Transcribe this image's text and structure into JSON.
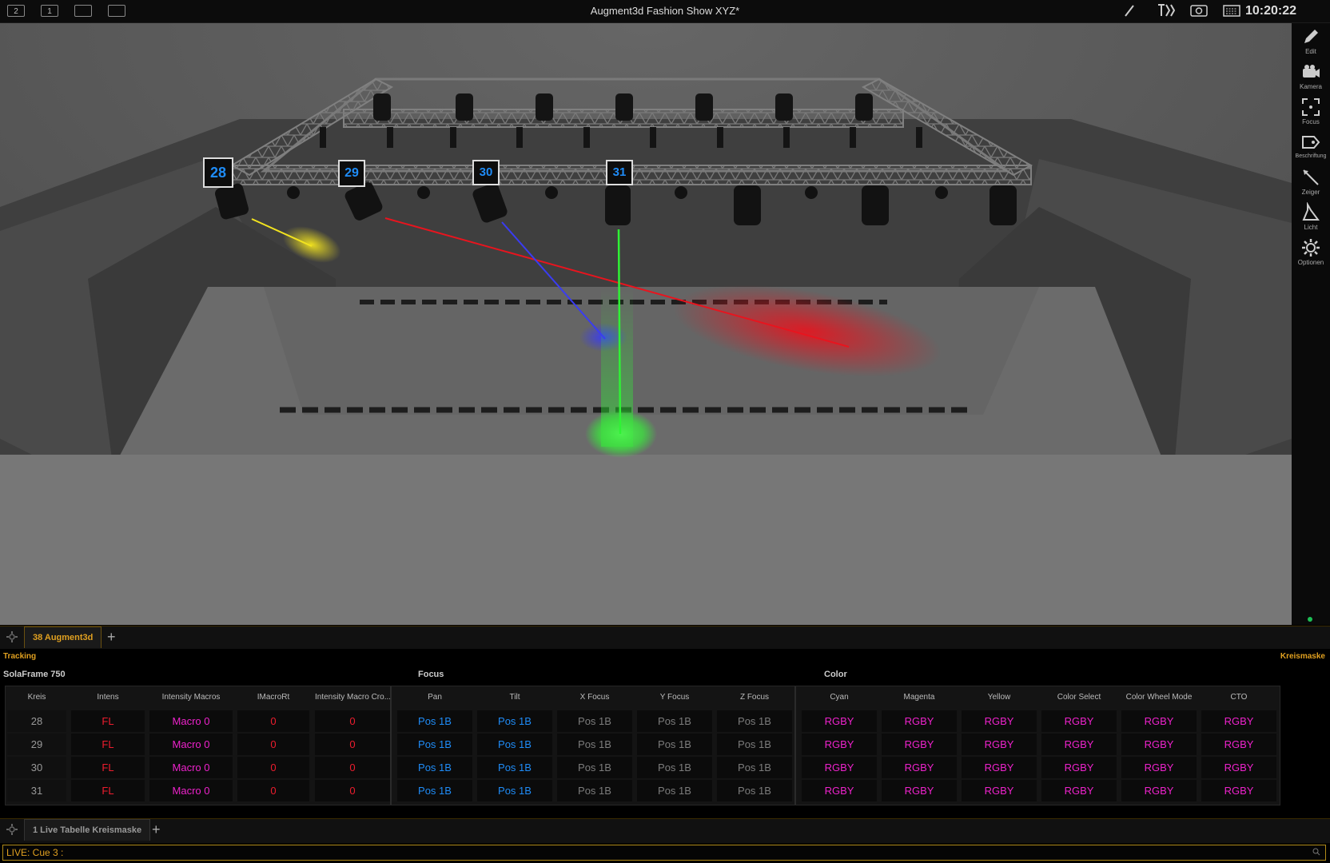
{
  "app": {
    "title": "Augment3d Fashion Show XYZ*",
    "clock": "10:20:22",
    "screen_buttons": [
      "2",
      "1",
      "",
      ""
    ]
  },
  "viewport": {
    "channel_labels": [
      "28",
      "29",
      "30",
      "31"
    ],
    "beam_colors": [
      "#f2e31f",
      "#e8141e",
      "#3a3cf2",
      "#2ff235"
    ]
  },
  "right_toolbar": [
    {
      "label": "Edit",
      "icon": "pencil-icon"
    },
    {
      "label": "Kamera",
      "icon": "camera-icon"
    },
    {
      "label": "Focus",
      "icon": "focus-icon"
    },
    {
      "label": "Beschriftung",
      "icon": "tag-icon"
    },
    {
      "label": "Zeiger",
      "icon": "pointer-icon"
    },
    {
      "label": "Licht",
      "icon": "light-icon"
    },
    {
      "label": "Optionen",
      "icon": "gear-icon"
    }
  ],
  "tabs_top": {
    "active": "38 Augment3d"
  },
  "sheet": {
    "mode_label": "Tracking",
    "mask_label": "Kreismaske",
    "fixture_name": "SolaFrame 750",
    "groups": {
      "focus": "Focus",
      "color": "Color"
    },
    "columns": [
      "Kreis",
      "Intens",
      "Intensity Macros",
      "IMacroRt",
      "Intensity Macro Cro...",
      "Pan",
      "Tilt",
      "X Focus",
      "Y Focus",
      "Z Focus",
      "Cyan",
      "Magenta",
      "Yellow",
      "Color Select",
      "Color Wheel Mode",
      "CTO"
    ],
    "rows": [
      [
        "28",
        "FL",
        "Macro 0",
        "0",
        "0",
        "Pos 1B",
        "Pos 1B",
        "Pos 1B",
        "Pos 1B",
        "Pos 1B",
        "RGBY",
        "RGBY",
        "RGBY",
        "RGBY",
        "RGBY",
        "RGBY"
      ],
      [
        "29",
        "FL",
        "Macro 0",
        "0",
        "0",
        "Pos 1B",
        "Pos 1B",
        "Pos 1B",
        "Pos 1B",
        "Pos 1B",
        "RGBY",
        "RGBY",
        "RGBY",
        "RGBY",
        "RGBY",
        "RGBY"
      ],
      [
        "30",
        "FL",
        "Macro 0",
        "0",
        "0",
        "Pos 1B",
        "Pos 1B",
        "Pos 1B",
        "Pos 1B",
        "Pos 1B",
        "RGBY",
        "RGBY",
        "RGBY",
        "RGBY",
        "RGBY",
        "RGBY"
      ],
      [
        "31",
        "FL",
        "Macro 0",
        "0",
        "0",
        "Pos 1B",
        "Pos 1B",
        "Pos 1B",
        "Pos 1B",
        "Pos 1B",
        "RGBY",
        "RGBY",
        "RGBY",
        "RGBY",
        "RGBY",
        "RGBY"
      ]
    ]
  },
  "tabs_bottom": {
    "active": "1 Live Tabelle Kreismaske"
  },
  "command_line": "LIVE: Cue  3 :",
  "colors": {
    "accent": "#e0a020",
    "red_value": "#ee1d2e",
    "magenta_value": "#ee22cc",
    "blue_value": "#1f8cf7",
    "gray_value": "#7c7c7c"
  }
}
